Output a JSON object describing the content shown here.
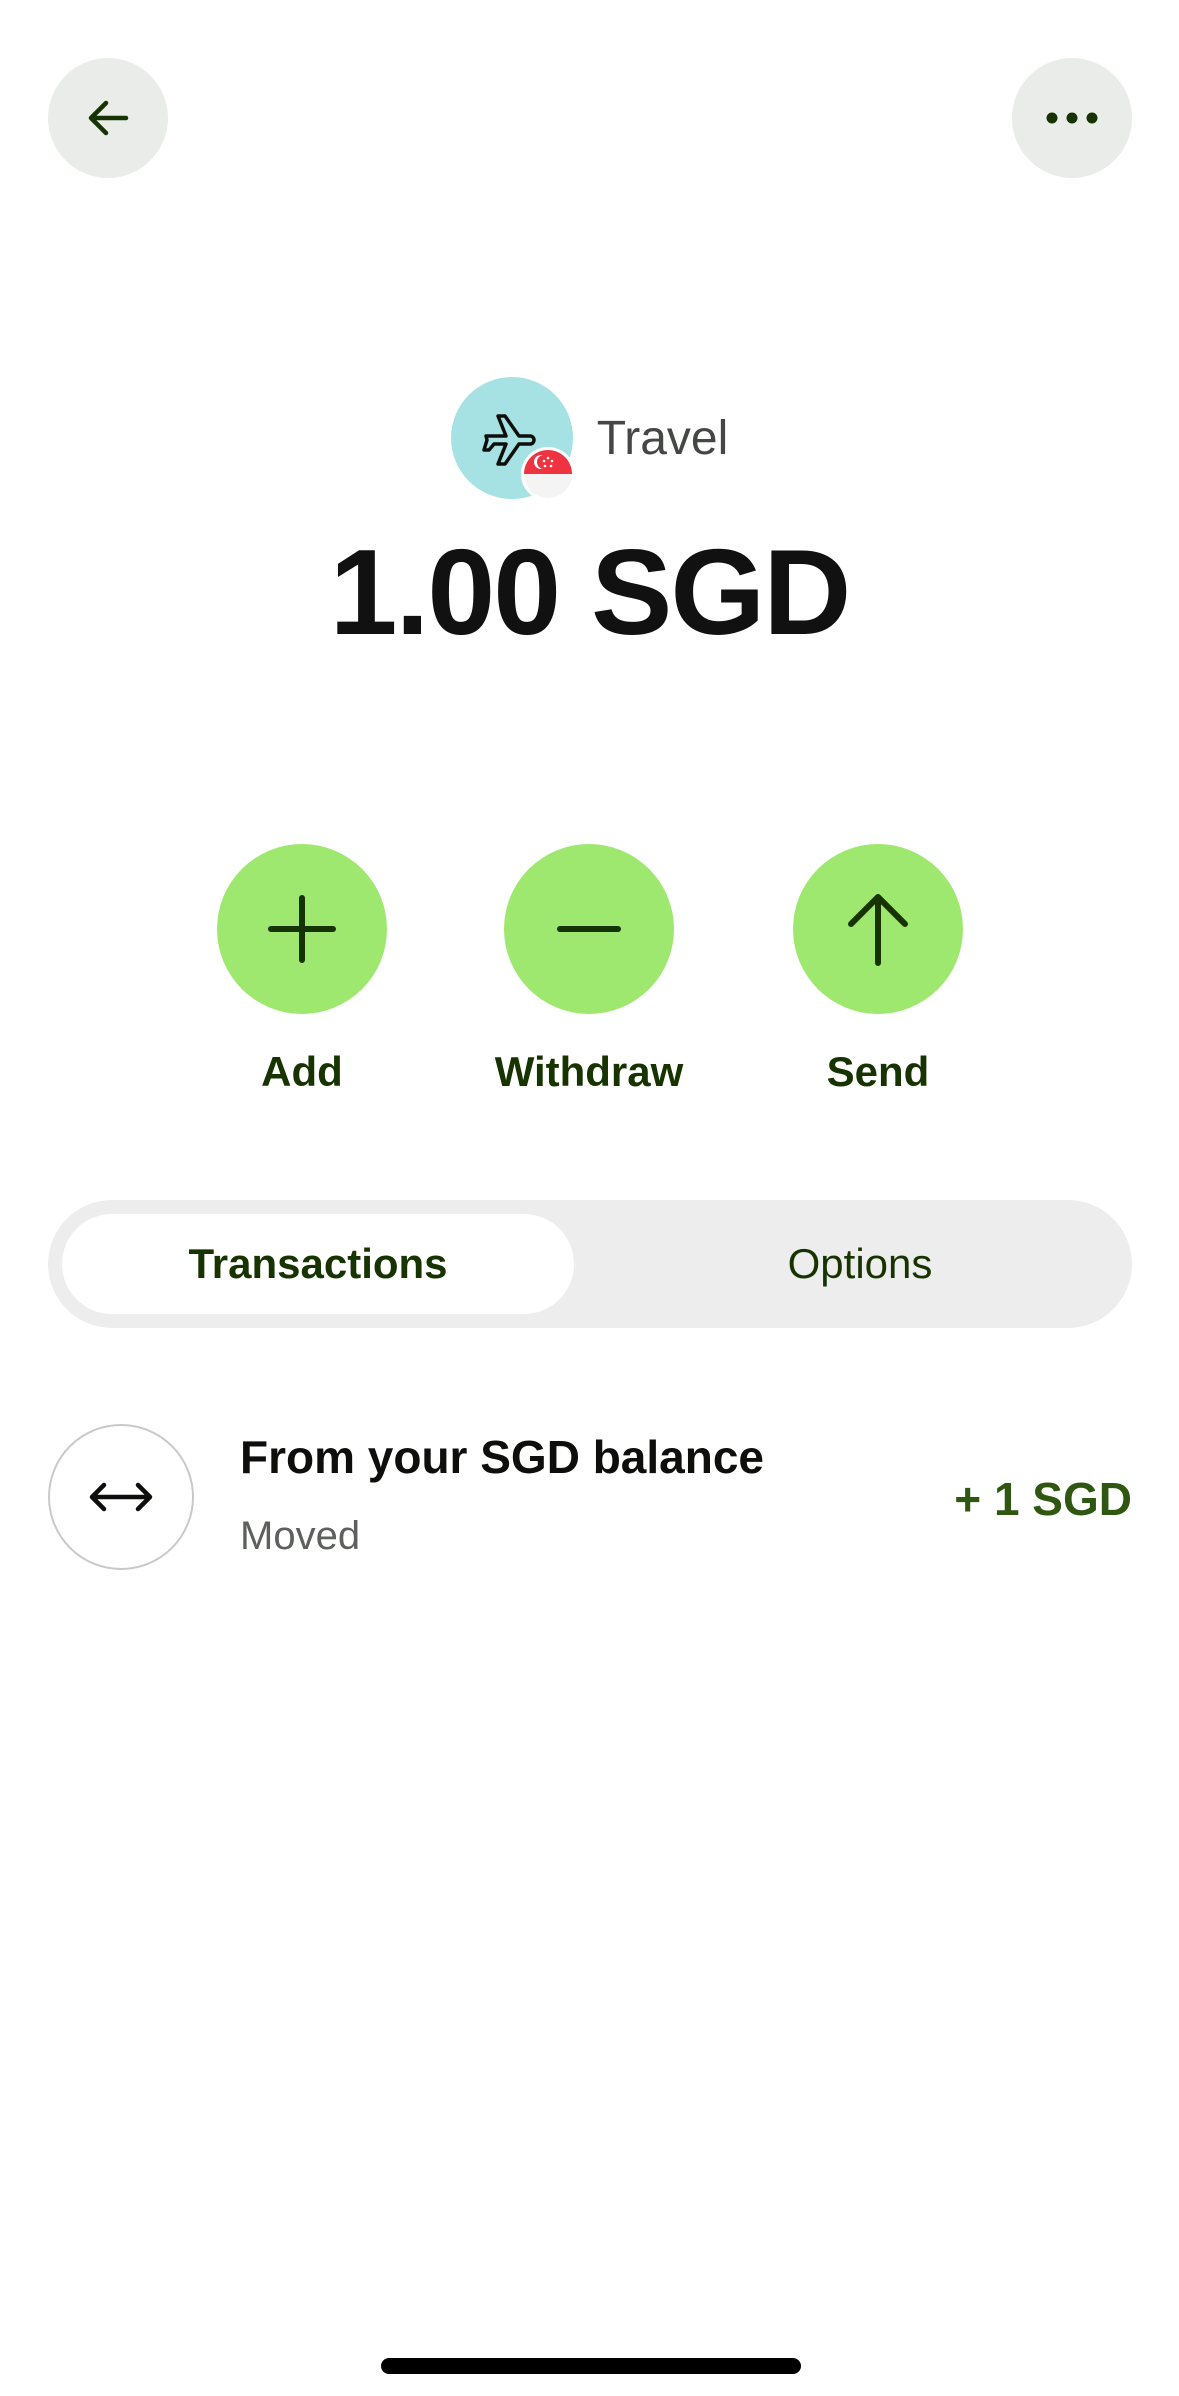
{
  "header": {
    "back_icon": "arrow-left-icon",
    "more_icon": "more-horizontal-icon"
  },
  "jar": {
    "name": "Travel",
    "icon": "airplane-icon",
    "flag": "singapore-flag-icon",
    "balance": "1.00 SGD"
  },
  "actions": [
    {
      "label": "Add",
      "icon": "plus-icon"
    },
    {
      "label": "Withdraw",
      "icon": "minus-icon"
    },
    {
      "label": "Send",
      "icon": "arrow-up-icon"
    }
  ],
  "tabs": [
    {
      "label": "Transactions",
      "active": true
    },
    {
      "label": "Options",
      "active": false
    }
  ],
  "transactions": [
    {
      "title": "From your SGD balance",
      "subtitle": "Moved",
      "amount": "+ 1 SGD",
      "icon": "arrows-left-right-icon"
    }
  ],
  "colors": {
    "accent_green": "#9fe870",
    "dark_green": "#163300",
    "amount_green": "#2f5711",
    "avatar_teal": "#a6e2e3",
    "button_gray": "#e9ece8"
  }
}
